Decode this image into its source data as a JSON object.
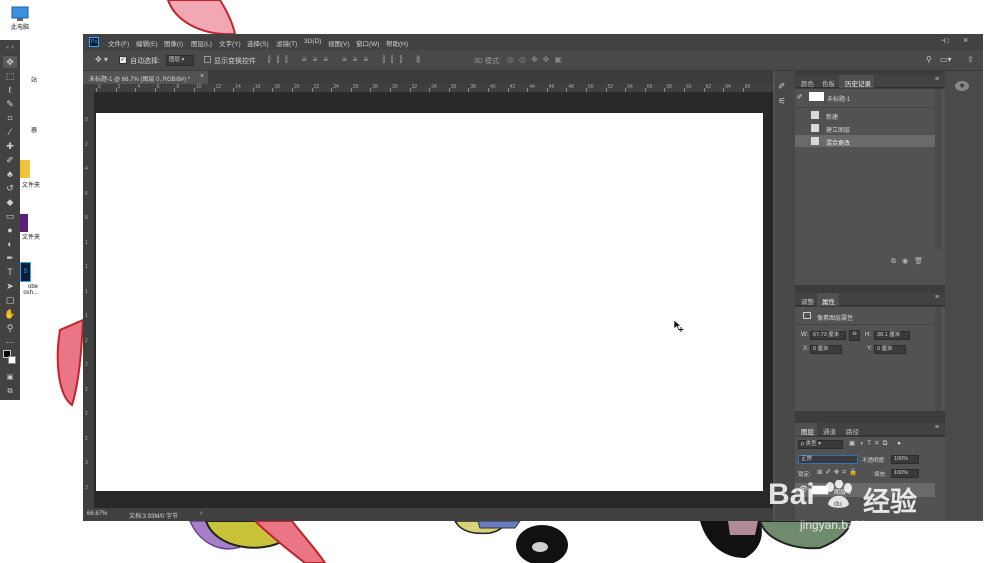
{
  "desktop": {
    "icons": [
      {
        "label": "此电脑"
      },
      {
        "label": "站"
      },
      {
        "label": "器"
      },
      {
        "label": "文件夹"
      },
      {
        "label": "文件夹"
      },
      {
        "label": "obe"
      },
      {
        "label": "osh..."
      }
    ]
  },
  "window": {
    "app_icon": "Ps",
    "menu": [
      "文件(F)",
      "编辑(E)",
      "图像(I)",
      "图层(L)",
      "文字(Y)",
      "选择(S)",
      "滤镜(T)",
      "3D(D)",
      "视图(V)",
      "窗口(W)",
      "帮助(H)"
    ],
    "controls": {
      "minimize": "−",
      "maximize": "□",
      "close": "×"
    }
  },
  "options_bar": {
    "auto_select_label": "自动选择:",
    "auto_select_value": "图层",
    "show_transform_label": "显示变换控件",
    "mode_3d_label": "3D 模式:"
  },
  "document": {
    "tab_title": "未标题-1 @ 66.7% (图层 0, RGB/8#) *",
    "tab_close": "×",
    "ruler_h_ticks": [
      "0",
      "2",
      "4",
      "6",
      "8",
      "10",
      "12",
      "14",
      "16",
      "18",
      "20",
      "22",
      "24",
      "26",
      "28",
      "30",
      "32",
      "34",
      "36",
      "38",
      "40",
      "42",
      "44",
      "46",
      "48",
      "50",
      "52",
      "54",
      "56",
      "58",
      "60",
      "62",
      "64",
      "66"
    ],
    "ruler_v_ticks": [
      "0",
      "2",
      "4",
      "6",
      "8",
      "1",
      "1",
      "1",
      "1",
      "2",
      "2",
      "2",
      "2",
      "2",
      "3",
      "3",
      "3"
    ],
    "zoom": "66.67%",
    "doc_info": "文档:3.93M/0 字节",
    "status_arrow": "›"
  },
  "panels": {
    "top_tabs": [
      "颜色",
      "色板",
      "历史记录"
    ],
    "history": {
      "snapshot": "未标题-1",
      "items": [
        "新建",
        "建立图层",
        "混合更改"
      ]
    },
    "props_tabs": [
      "调整",
      "属性"
    ],
    "properties": {
      "heading": "像素图层属性",
      "w_label": "W:",
      "w_value": "67.73 厘米",
      "link": "⊖",
      "h_label": "H:",
      "h_value": "38.1 厘米",
      "x_label": "X:",
      "x_value": "0 厘米",
      "y_label": "Y:",
      "y_value": "0 厘米"
    },
    "layers_tabs": [
      "图层",
      "通道",
      "路径"
    ],
    "layers": {
      "filter_label": "ρ 类型",
      "blend_mode": "正常",
      "opacity_label": "不透明度:",
      "opacity_value": "100%",
      "lock_label": "锁定:",
      "fill_label": "填充:",
      "fill_value": "100%",
      "layer_name": "图层 0"
    }
  },
  "watermark": {
    "brand": "Bai",
    "brand2": "du",
    "cn": "经验",
    "url": "jingyan.baidu.com"
  },
  "colors": {
    "ps_bg": "#535353",
    "ps_dark": "#282828",
    "accent": "#2b6fc7"
  }
}
